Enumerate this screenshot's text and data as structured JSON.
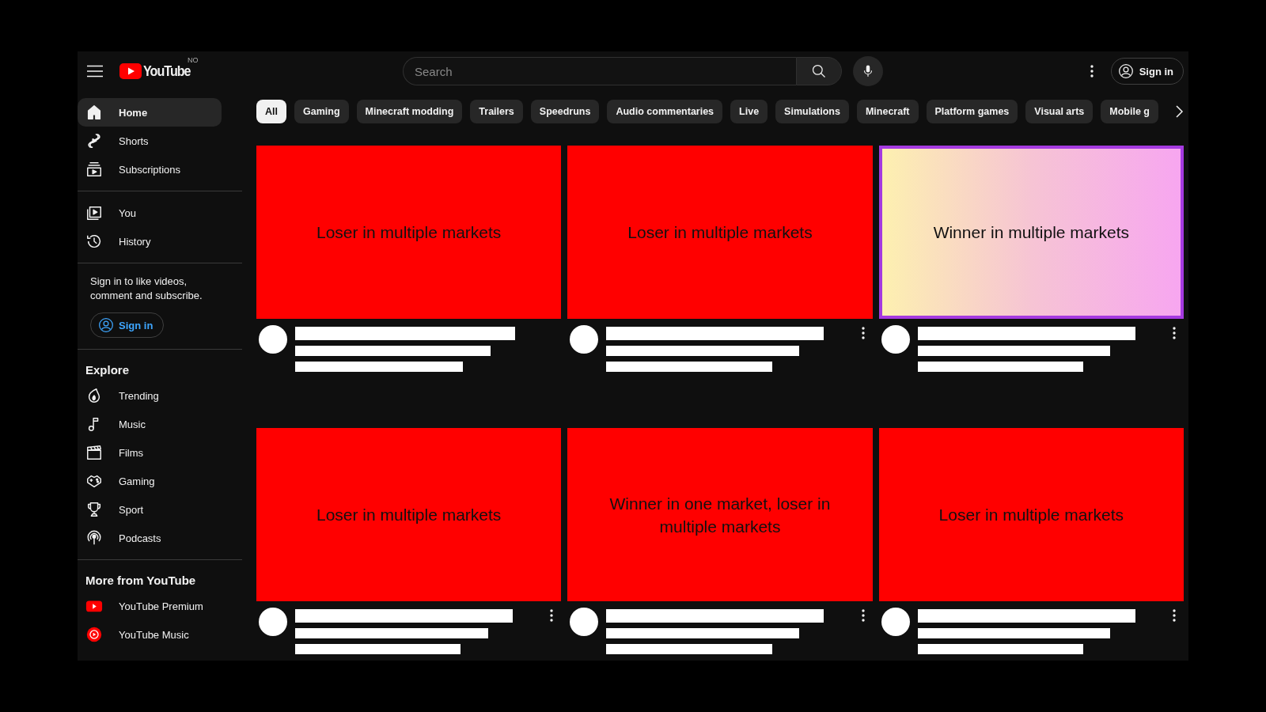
{
  "header": {
    "logo": "YouTube",
    "country": "NO",
    "search": {
      "placeholder": "Search"
    },
    "sign_in": "Sign in"
  },
  "sidebar": {
    "main": [
      {
        "kind": "home",
        "label": "Home",
        "selected": true
      },
      {
        "kind": "shorts",
        "label": "Shorts",
        "selected": false
      },
      {
        "kind": "subscriptions",
        "label": "Subscriptions",
        "selected": false
      }
    ],
    "you": [
      {
        "kind": "you",
        "label": "You",
        "selected": false
      },
      {
        "kind": "history",
        "label": "History",
        "selected": false
      }
    ],
    "sign_in_prompt": {
      "text": "Sign in to like videos, comment and subscribe.",
      "button": "Sign in"
    },
    "explore": {
      "title": "Explore",
      "items": [
        {
          "kind": "trending",
          "label": "Trending",
          "selected": false
        },
        {
          "kind": "music",
          "label": "Music",
          "selected": false
        },
        {
          "kind": "films",
          "label": "Films",
          "selected": false
        },
        {
          "kind": "gaming",
          "label": "Gaming",
          "selected": false
        },
        {
          "kind": "sport",
          "label": "Sport",
          "selected": false
        },
        {
          "kind": "podcasts",
          "label": "Podcasts",
          "selected": false
        }
      ]
    },
    "more": {
      "title": "More from YouTube",
      "items": [
        {
          "kind": "premium",
          "label": "YouTube Premium",
          "selected": false
        },
        {
          "kind": "music_app",
          "label": "YouTube Music",
          "selected": false
        }
      ]
    }
  },
  "chips": [
    {
      "label": "All",
      "selected": true
    },
    {
      "label": "Gaming",
      "selected": false
    },
    {
      "label": "Minecraft modding",
      "selected": false
    },
    {
      "label": "Trailers",
      "selected": false
    },
    {
      "label": "Speedruns",
      "selected": false
    },
    {
      "label": "Audio commentaries",
      "selected": false
    },
    {
      "label": "Live",
      "selected": false
    },
    {
      "label": "Simulations",
      "selected": false
    },
    {
      "label": "Minecraft",
      "selected": false
    },
    {
      "label": "Platform games",
      "selected": false
    },
    {
      "label": "Visual arts",
      "selected": false
    },
    {
      "label": "Mobile g",
      "selected": false
    }
  ],
  "videos": [
    {
      "title": "Loser in multiple markets",
      "highlighted": false,
      "menu": false
    },
    {
      "title": "Loser in multiple markets",
      "highlighted": false,
      "menu": true
    },
    {
      "title": "Winner in multiple markets",
      "highlighted": true,
      "menu": true
    },
    {
      "title": "Loser in multiple markets",
      "highlighted": false,
      "menu": true
    },
    {
      "title": "Winner in one market, loser in multiple markets",
      "highlighted": false,
      "menu": true
    },
    {
      "title": "Loser in multiple markets",
      "highlighted": false,
      "menu": true
    }
  ]
}
